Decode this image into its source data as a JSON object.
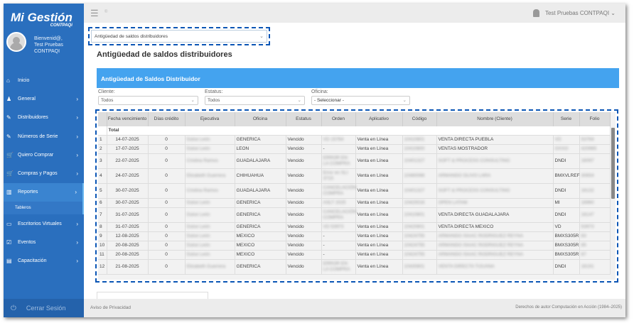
{
  "brand": {
    "name": "Mi Gestión",
    "sub": "CONTPAQi"
  },
  "user": {
    "welcome": "Bienvenid@,",
    "name": "Test Pruebas CONTPAQI",
    "topbar_name": "Test Pruebas CONTPAQI"
  },
  "sidebar": {
    "items": [
      {
        "label": "Inicio",
        "icon": "⌂",
        "chev": ""
      },
      {
        "label": "General",
        "icon": "♟",
        "chev": "›"
      },
      {
        "label": "Distribuidores",
        "icon": "✎",
        "chev": "›"
      },
      {
        "label": "Números de Serie",
        "icon": "✎",
        "chev": "›"
      },
      {
        "label": "Quiero Comprar",
        "icon": "🛒",
        "chev": "›"
      },
      {
        "label": "Compras y Pagos",
        "icon": "🛒",
        "chev": "›"
      },
      {
        "label": "Reportes",
        "icon": "▥",
        "chev": "›"
      }
    ],
    "subitem": "Tableros",
    "items2": [
      {
        "label": "Escritorios Virtuales",
        "icon": "▭",
        "chev": "›"
      },
      {
        "label": "Eventos",
        "icon": "☑",
        "chev": "›"
      },
      {
        "label": "Capacitación",
        "icon": "▤",
        "chev": "›"
      }
    ],
    "logout": "Cerrar Sesión"
  },
  "report_select": "Antigüedad de saldos distribuidores",
  "page_title": "Antigüedad de saldos distribuidores",
  "panel_title": "Antigüedad de Saldos Distribuidor",
  "filters": [
    {
      "label": "Cliente:",
      "value": "Todos"
    },
    {
      "label": "Estatus:",
      "value": "Todos"
    },
    {
      "label": "Oficina:",
      "value": "- Seleccionar -"
    }
  ],
  "table": {
    "columns": [
      "",
      "Fecha vencimiento",
      "Días crédito",
      "Ejecutiva",
      "Oficina",
      "Estatus",
      "Orden",
      "Aplicativo",
      "Código",
      "Nombre (Cliente)",
      "Serie",
      "Folio"
    ],
    "total_label": "Total",
    "rows": [
      [
        "1",
        "14-07-2025",
        "0",
        "Dulce León",
        "GENERICA",
        "Vencido",
        "VD 15764",
        "Venta en Línea",
        "10410801",
        "VENTA DIRECTA PUEBLA",
        "VD",
        "53764"
      ],
      [
        "2",
        "17-07-2025",
        "0",
        "Dulce León",
        "LEON",
        "Vencido",
        "-",
        "Venta en Línea",
        "10410800",
        "VENTAS MOSTRADOR",
        "OXXO",
        "420965"
      ],
      [
        "3",
        "22-07-2025",
        "0",
        "Cristina Ramos",
        "GUADALAJARA",
        "Vencido",
        "ERROR EN LA COMPRA",
        "Venta en Línea",
        "10401327",
        "SOFT & PROCESS CONSULTING",
        "DNDI",
        "16097"
      ],
      [
        "4",
        "24-07-2025",
        "0",
        "Elizabeth Guerrera",
        "CHIHUAHUA",
        "Vencido",
        "Error en SLI 3715",
        "Venta en Línea",
        "10480066",
        "ARMANDO OLIVO LARA",
        "BMXVLREF",
        "30654"
      ],
      [
        "5",
        "30-07-2025",
        "0",
        "Cristina Ramos",
        "GUADALAJARA",
        "Vencido",
        "CANCELACIÓN COMPRA",
        "Venta en Línea",
        "10401327",
        "SOFT & PROCESS CONSULTING",
        "DNDI",
        "16132"
      ],
      [
        "6",
        "30-07-2025",
        "0",
        "Dulce León",
        "GENERICA",
        "Vencido",
        "ASLT 2025",
        "Venta en Línea",
        "10420016",
        "OPEN LATAM",
        "MI",
        "16960"
      ],
      [
        "7",
        "31-07-2025",
        "0",
        "Dulce León",
        "GENERICA",
        "Vencido",
        "CANCELACIÓN COMPRA",
        "Venta en Línea",
        "10410801",
        "VENTA DIRECTA GUADALAJARA",
        "DNDI",
        "16147"
      ],
      [
        "8",
        "31-07-2025",
        "0",
        "Dulce León",
        "GENERICA",
        "Vencido",
        "VD 53973",
        "Venta en Línea",
        "10420801",
        "VENTA DIRECTA MEXICO",
        "VD",
        "53973"
      ],
      [
        "9",
        "12-08-2025",
        "0",
        "Dulce León",
        "MEXICO",
        "Vencido",
        "-",
        "Venta en Línea",
        "10424755",
        "ARMANDO ISAAC RODRIGUEZ REYNA",
        "BMXS305R",
        "83"
      ],
      [
        "10",
        "20-08-2025",
        "0",
        "Dulce León",
        "MEXICO",
        "Vencido",
        "-",
        "Venta en Línea",
        "10424755",
        "ARMANDO ISAAC RODRIGUEZ REYNA",
        "BMXS305R",
        "85"
      ],
      [
        "11",
        "20-08-2025",
        "0",
        "Dulce León",
        "MEXICO",
        "Vencido",
        "-",
        "Venta en Línea",
        "10424755",
        "ARMANDO ISAAC RODRIGUEZ REYNA",
        "BMXS305R",
        "87"
      ],
      [
        "12",
        "21-08-2025",
        "0",
        "Elizabeth Guerrera",
        "GENERICA",
        "Vencido",
        "ERROR EN LA COMPRA",
        "Venta en Línea",
        "10430801",
        "VENTA DIRECTA TIJUANA",
        "DNDI",
        "16191"
      ]
    ],
    "blurred_cols": [
      3,
      6,
      8,
      9,
      11
    ],
    "clear_nombre_rows": [
      0,
      1,
      6,
      7
    ],
    "clear_serie_rows": [
      2,
      3,
      4,
      5,
      6,
      7,
      8,
      9,
      10,
      11
    ]
  },
  "footer": {
    "privacy": "Aviso de Privacidad",
    "copyright": "Derechos de autor Computación en Acción (1984–2025)"
  }
}
